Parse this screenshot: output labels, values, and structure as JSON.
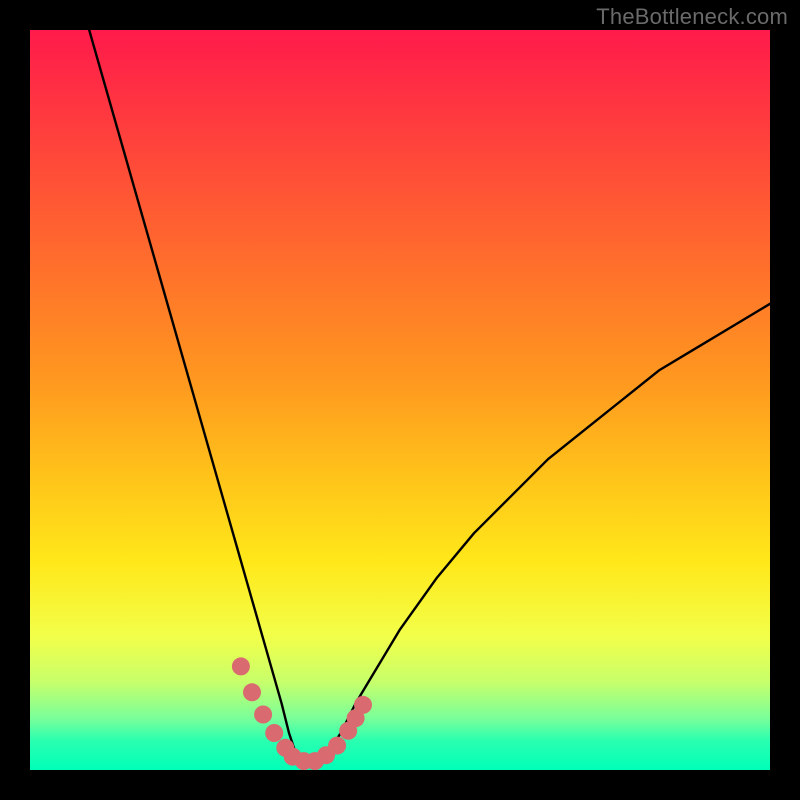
{
  "watermark": {
    "text": "TheBottleneck.com"
  },
  "chart_data": {
    "type": "line",
    "title": "",
    "xlabel": "",
    "ylabel": "",
    "xlim": [
      0,
      100
    ],
    "ylim": [
      0,
      100
    ],
    "series": [
      {
        "name": "bottleneck-curve",
        "x": [
          8,
          10,
          12,
          14,
          16,
          18,
          20,
          22,
          24,
          26,
          28,
          30,
          32,
          34,
          35,
          36,
          37,
          38,
          40,
          42,
          44,
          47,
          50,
          55,
          60,
          65,
          70,
          75,
          80,
          85,
          90,
          95,
          100
        ],
        "y": [
          100,
          93,
          86,
          79,
          72,
          65,
          58,
          51,
          44,
          37,
          30,
          23,
          16,
          9,
          5,
          2,
          1,
          1,
          2,
          5,
          9,
          14,
          19,
          26,
          32,
          37,
          42,
          46,
          50,
          54,
          57,
          60,
          63
        ]
      }
    ],
    "markers": {
      "name": "highlight-points",
      "color": "#d96a6f",
      "x": [
        28.5,
        30.0,
        31.5,
        33.0,
        34.5,
        35.5,
        37.0,
        38.5,
        40.0,
        41.5,
        43.0,
        44.0,
        45.0
      ],
      "y": [
        14.0,
        10.5,
        7.5,
        5.0,
        3.0,
        1.8,
        1.2,
        1.2,
        2.0,
        3.3,
        5.3,
        7.0,
        8.8
      ]
    }
  }
}
